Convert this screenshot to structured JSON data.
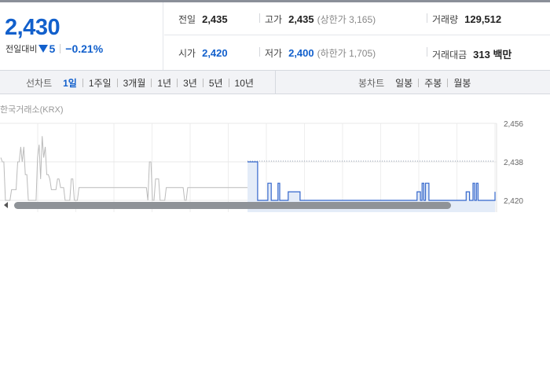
{
  "price": {
    "current": "2,430",
    "change_label": "전일대비",
    "change_icon": "down-triangle-icon",
    "change_amount": "5",
    "change_percent": "−0.21%",
    "color": "#1260cc"
  },
  "stats": {
    "prev_close": {
      "label": "전일",
      "value": "2,435"
    },
    "high": {
      "label": "고가",
      "value": "2,435",
      "limit": "(상한가 3,165)"
    },
    "volume": {
      "label": "거래량",
      "value": "129,512"
    },
    "open": {
      "label": "시가",
      "value": "2,420"
    },
    "low": {
      "label": "저가",
      "value": "2,400",
      "limit": "(하한가 1,705)"
    },
    "amount": {
      "label": "거래대금",
      "value": "313 백만"
    }
  },
  "tabs": {
    "line_title": "선차트",
    "line_items": [
      "1일",
      "1주일",
      "3개월",
      "1년",
      "3년",
      "5년",
      "10년"
    ],
    "line_active": "1일",
    "candle_title": "봉차트",
    "candle_items": [
      "일봉",
      "주봉",
      "월봉"
    ]
  },
  "chart": {
    "source": "한국거래소(KRX)",
    "y_labels": [
      "2,456",
      "2,438",
      "2,420"
    ]
  },
  "chart_data": {
    "type": "line",
    "series": [
      {
        "color": "#bbbbbb",
        "values": [
          2440,
          2438,
          2438,
          2420,
          2420,
          2420,
          2420,
          2425,
          2425,
          2425,
          2425,
          2438,
          2438,
          2445,
          2438,
          2445,
          2432,
          2432,
          2420,
          2420,
          2420,
          2420,
          2420,
          2420,
          2440,
          2446,
          2430,
          2450,
          2440,
          2445,
          2432,
          2432,
          2430,
          2425,
          2425,
          2425,
          2425,
          2430,
          2430,
          2426,
          2426,
          2426,
          2420,
          2420,
          2420,
          2420,
          2430,
          2430,
          2420,
          2420,
          2420,
          2426,
          2426,
          2426,
          2426,
          2426,
          2426,
          2426,
          2426,
          2426,
          2426,
          2426,
          2426,
          2426,
          2426,
          2426,
          2426,
          2426,
          2426,
          2426,
          2426,
          2426,
          2426,
          2426,
          2426,
          2426,
          2426,
          2426,
          2426,
          2426,
          2426,
          2426,
          2426,
          2426,
          2426,
          2426,
          2426,
          2426,
          2426,
          2426,
          2426,
          2426,
          2426,
          2426,
          2426,
          2426,
          2420,
          2438,
          2438,
          2420,
          2420,
          2430,
          2430,
          2430,
          2420,
          2420,
          2420,
          2420,
          2426,
          2426,
          2426,
          2426,
          2426,
          2426,
          2426,
          2426,
          2426,
          2426,
          2426,
          2426,
          2420,
          2420,
          2426,
          2426,
          2426,
          2426,
          2426,
          2426,
          2426,
          2426,
          2426,
          2426,
          2426,
          2426,
          2426,
          2426,
          2426,
          2426,
          2426,
          2426,
          2426,
          2426,
          2426,
          2426,
          2426,
          2426,
          2426,
          2426,
          2426,
          2426,
          2426,
          2426,
          2426,
          2426,
          2426,
          2426,
          2426,
          2426,
          2426,
          2426,
          2426,
          2426
        ]
      },
      {
        "color": "#3366cc",
        "values": [
          2438,
          2438,
          2438,
          2438,
          2438,
          2438,
          2420,
          2420,
          2420,
          2420,
          2420,
          2420,
          2428,
          2428,
          2420,
          2420,
          2420,
          2420,
          2428,
          2420,
          2420,
          2420,
          2420,
          2420,
          2424,
          2424,
          2424,
          2424,
          2424,
          2424,
          2424,
          2420,
          2420,
          2420,
          2420,
          2420,
          2420,
          2420,
          2420,
          2420,
          2420,
          2420,
          2420,
          2420,
          2420,
          2420,
          2420,
          2420,
          2420,
          2420,
          2420,
          2420,
          2420,
          2420,
          2420,
          2420,
          2420,
          2420,
          2420,
          2420,
          2420,
          2420,
          2420,
          2420,
          2420,
          2420,
          2420,
          2420,
          2420,
          2420,
          2420,
          2420,
          2420,
          2420,
          2420,
          2420,
          2420,
          2420,
          2420,
          2420,
          2420,
          2420,
          2420,
          2420,
          2420,
          2420,
          2420,
          2420,
          2420,
          2420,
          2420,
          2420,
          2420,
          2420,
          2420,
          2420,
          2420,
          2420,
          2420,
          2420,
          2424,
          2424,
          2420,
          2428,
          2420,
          2428,
          2428,
          2420,
          2420,
          2420,
          2420,
          2420,
          2420,
          2420,
          2420,
          2420,
          2420,
          2420,
          2420,
          2420,
          2420,
          2420,
          2420,
          2420,
          2420,
          2420,
          2420,
          2420,
          2420,
          2424,
          2424,
          2420,
          2420,
          2428,
          2420,
          2428,
          2420,
          2420,
          2420,
          2420,
          2420,
          2420,
          2420,
          2420,
          2420,
          2420,
          2424
        ]
      }
    ],
    "ylim": [
      2420,
      2456
    ],
    "grid": true
  }
}
